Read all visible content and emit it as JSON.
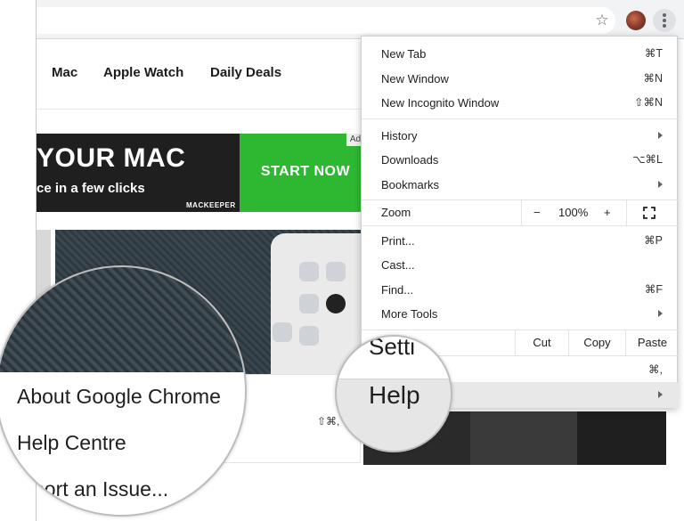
{
  "browser": {
    "star_icon": "star-icon",
    "menu_icon": "three-dots-icon"
  },
  "nav": {
    "items": [
      "Mac",
      "Apple Watch",
      "Daily Deals"
    ]
  },
  "ad": {
    "headline": "YOUR MAC",
    "subline": "ce in a few clicks",
    "brand": "MACKEEPER",
    "cta": "START NOW",
    "tag": "Ad"
  },
  "article": {
    "shortcut": "⇧⌘,"
  },
  "menu": {
    "new_tab": {
      "label": "New Tab",
      "shortcut": "⌘T"
    },
    "new_window": {
      "label": "New Window",
      "shortcut": "⌘N"
    },
    "new_incognito": {
      "label": "New Incognito Window",
      "shortcut": "⇧⌘N"
    },
    "history": {
      "label": "History"
    },
    "downloads": {
      "label": "Downloads",
      "shortcut": "⌥⌘L"
    },
    "bookmarks": {
      "label": "Bookmarks"
    },
    "zoom": {
      "label": "Zoom",
      "minus": "−",
      "level": "100%",
      "plus": "+"
    },
    "print": {
      "label": "Print...",
      "shortcut": "⌘P"
    },
    "cast": {
      "label": "Cast..."
    },
    "find": {
      "label": "Find...",
      "shortcut": "⌘F"
    },
    "more_tools": {
      "label": "More Tools"
    },
    "edit": {
      "cut": "Cut",
      "copy": "Copy",
      "paste": "Paste"
    },
    "settings": {
      "shortcut": "⌘,"
    },
    "help": {
      "label": ""
    }
  },
  "magnifier_left": {
    "items": [
      "About Google Chrome",
      "Help Centre",
      "port an Issue..."
    ]
  },
  "magnifier_right": {
    "settings": "Setti",
    "help": "Help"
  }
}
